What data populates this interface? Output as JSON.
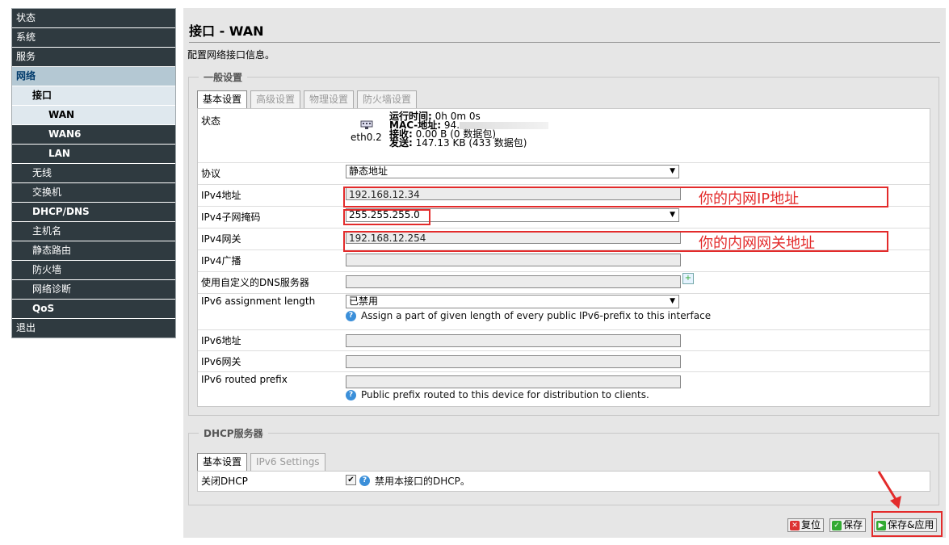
{
  "sidebar": {
    "items": [
      {
        "label": "状态"
      },
      {
        "label": "系统"
      },
      {
        "label": "服务"
      },
      {
        "label": "网络"
      },
      {
        "label": "接口"
      },
      {
        "label": "WAN"
      },
      {
        "label": "WAN6"
      },
      {
        "label": "LAN"
      },
      {
        "label": "无线"
      },
      {
        "label": "交换机"
      },
      {
        "label": "DHCP/DNS"
      },
      {
        "label": "主机名"
      },
      {
        "label": "静态路由"
      },
      {
        "label": "防火墙"
      },
      {
        "label": "网络诊断"
      },
      {
        "label": "QoS"
      },
      {
        "label": "退出"
      }
    ]
  },
  "page": {
    "title": "接口 - WAN",
    "description": "配置网络接口信息。"
  },
  "general": {
    "legend": "一般设置",
    "tabs": [
      "基本设置",
      "高级设置",
      "物理设置",
      "防火墙设置"
    ],
    "status_label": "状态",
    "iface_name": "eth0.2",
    "uptime_label": "运行时间:",
    "uptime_value": "0h 0m 0s",
    "mac_label": "MAC-地址:",
    "mac_value": "94.",
    "rx_label": "接收:",
    "rx_value": "0.00 B (0 数据包)",
    "tx_label": "发送:",
    "tx_value": "147.13 KB (433 数据包)",
    "protocol_label": "协议",
    "protocol_value": "静态地址",
    "ipv4_addr_label": "IPv4地址",
    "ipv4_addr_value": "192.168.12.34",
    "netmask_label": "IPv4子网掩码",
    "netmask_value": "255.255.255.0",
    "gateway_label": "IPv4网关",
    "gateway_value": "192.168.12.254",
    "broadcast_label": "IPv4广播",
    "broadcast_value": "",
    "dns_label": "使用自定义的DNS服务器",
    "dns_value": "",
    "ipv6_len_label": "IPv6 assignment length",
    "ipv6_len_value": "已禁用",
    "ipv6_len_help": "Assign a part of given length of every public IPv6-prefix to this interface",
    "ipv6_addr_label": "IPv6地址",
    "ipv6_addr_value": "",
    "ipv6_gw_label": "IPv6网关",
    "ipv6_gw_value": "",
    "ipv6_prefix_label": "IPv6 routed prefix",
    "ipv6_prefix_value": "",
    "ipv6_prefix_help": "Public prefix routed to this device for distribution to clients."
  },
  "annotations": {
    "ip_note": "你的内网IP地址",
    "gw_note": "你的内网网关地址"
  },
  "dhcp": {
    "legend": "DHCP服务器",
    "tabs": [
      "基本设置",
      "IPv6 Settings"
    ],
    "close_label": "关闭DHCP",
    "close_help": "禁用本接口的DHCP。",
    "close_checked": true
  },
  "buttons": {
    "reset": "复位",
    "save": "保存",
    "save_apply": "保存&应用"
  },
  "colors": {
    "annotation": "#e32b2b",
    "sidebar_bg": "#2f3a40",
    "active_bg": "#b4c8d3"
  }
}
